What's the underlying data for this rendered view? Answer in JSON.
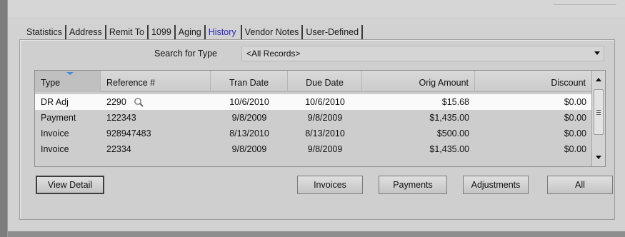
{
  "tabs": [
    {
      "label": "Statistics"
    },
    {
      "label": "Address"
    },
    {
      "label": "Remit To"
    },
    {
      "label": "1099"
    },
    {
      "label": "Aging"
    },
    {
      "label": "History",
      "active": true
    },
    {
      "label": "Vendor Notes"
    },
    {
      "label": "User-Defined"
    }
  ],
  "search": {
    "label": "Search for Type",
    "value": "<All Records>"
  },
  "table": {
    "columns": [
      "Type",
      "Reference #",
      "Tran Date",
      "Due Date",
      "Orig Amount",
      "Discount"
    ],
    "rows": [
      {
        "type": "DR Adj",
        "ref": "2290",
        "tran": "10/6/2010",
        "due": "10/6/2010",
        "amount": "$15.68",
        "discount": "$0.00",
        "selected": true
      },
      {
        "type": "Payment",
        "ref": "122343",
        "tran": "9/8/2009",
        "due": "9/8/2009",
        "amount": "$1,435.00",
        "discount": "$0.00"
      },
      {
        "type": "Invoice",
        "ref": "928947483",
        "tran": "8/13/2010",
        "due": "8/13/2010",
        "amount": "$500.00",
        "discount": "$0.00"
      },
      {
        "type": "Invoice",
        "ref": "22334",
        "tran": "9/8/2009",
        "due": "9/8/2009",
        "amount": "$1,435.00",
        "discount": "$0.00"
      }
    ]
  },
  "buttons": {
    "view_detail": "View Detail",
    "invoices": "Invoices",
    "payments": "Payments",
    "adjustments": "Adjustments",
    "all": "All"
  },
  "colors": {
    "active_tab": "#2a2ab8",
    "sort_indicator": "#4a89d9",
    "selected_row": "#fafafa"
  }
}
